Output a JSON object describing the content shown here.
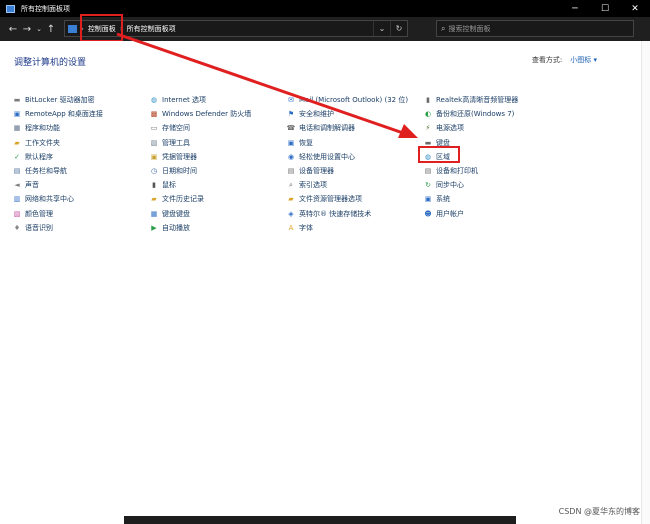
{
  "window": {
    "title": "所有控制面板项",
    "minimize": "─",
    "maximize": "☐",
    "close": "✕"
  },
  "nav": {
    "back": "←",
    "forward": "→",
    "recent": "⌄",
    "up": "↑",
    "breadcrumb": [
      "控制面板",
      "所有控制面板项"
    ],
    "sep": "›",
    "dropdown": "⌄",
    "refresh": "↻",
    "search_placeholder": "搜索控制面板"
  },
  "main": {
    "heading": "调整计算机的设置",
    "view_by_label": "查看方式:",
    "view_by_value": "小图标 ▾"
  },
  "columns": [
    [
      {
        "label": "BitLocker 驱动器加密",
        "icon": "drive-lock-icon",
        "color": "#7a7a7a",
        "glyph": "▬"
      },
      {
        "label": "RemoteApp 和桌面连接",
        "icon": "remote-desktop-icon",
        "color": "#2b6cc4",
        "glyph": "▣"
      },
      {
        "label": "程序和功能",
        "icon": "programs-icon",
        "color": "#5a6c86",
        "glyph": "▦"
      },
      {
        "label": "工作文件夹",
        "icon": "work-folder-icon",
        "color": "#d9a32a",
        "glyph": "▰"
      },
      {
        "label": "默认程序",
        "icon": "default-programs-icon",
        "color": "#2e9e4a",
        "glyph": "✓"
      },
      {
        "label": "任务栏和导航",
        "icon": "taskbar-icon",
        "color": "#4a6a9a",
        "glyph": "▤"
      },
      {
        "label": "声音",
        "icon": "sound-icon",
        "color": "#7a7a7a",
        "glyph": "◄"
      },
      {
        "label": "网络和共享中心",
        "icon": "network-icon",
        "color": "#2b6cc4",
        "glyph": "▥"
      },
      {
        "label": "颜色管理",
        "icon": "color-management-icon",
        "color": "#c84b9e",
        "glyph": "▧"
      },
      {
        "label": "语音识别",
        "icon": "microphone-icon",
        "color": "#888888",
        "glyph": "♦"
      }
    ],
    [
      {
        "label": "Internet 选项",
        "icon": "internet-options-icon",
        "color": "#2b8cc4",
        "glyph": "◍"
      },
      {
        "label": "Windows Defender 防火墙",
        "icon": "firewall-icon",
        "color": "#b04020",
        "glyph": "▩"
      },
      {
        "label": "存储空间",
        "icon": "storage-icon",
        "color": "#6a6a6a",
        "glyph": "▭"
      },
      {
        "label": "管理工具",
        "icon": "admin-tools-icon",
        "color": "#6a7a8a",
        "glyph": "▨"
      },
      {
        "label": "凭据管理器",
        "icon": "credential-icon",
        "color": "#c8a030",
        "glyph": "▣"
      },
      {
        "label": "日期和时间",
        "icon": "clock-icon",
        "color": "#3a6aa4",
        "glyph": "◷"
      },
      {
        "label": "鼠标",
        "icon": "mouse-icon",
        "color": "#555555",
        "glyph": "▮"
      },
      {
        "label": "文件历史记录",
        "icon": "file-history-icon",
        "color": "#d9a32a",
        "glyph": "▰"
      },
      {
        "label": "键盘键盘",
        "icon": "troubleshoot-icon",
        "color": "#2b6cc4",
        "glyph": "▦"
      },
      {
        "label": "自动播放",
        "icon": "autoplay-icon",
        "color": "#2e9e4a",
        "glyph": "▶"
      }
    ],
    [
      {
        "label": "Mail (Microsoft Outlook) (32 位)",
        "icon": "mail-icon",
        "color": "#2b6cc4",
        "glyph": "✉"
      },
      {
        "label": "安全和维护",
        "icon": "flag-icon",
        "color": "#2b6cc4",
        "glyph": "⚑"
      },
      {
        "label": "电话和调制解调器",
        "icon": "phone-icon",
        "color": "#6a6a6a",
        "glyph": "☎"
      },
      {
        "label": "恢复",
        "icon": "recovery-icon",
        "color": "#2b6cc4",
        "glyph": "▣"
      },
      {
        "label": "轻松使用设置中心",
        "icon": "ease-of-access-icon",
        "color": "#2b6cc4",
        "glyph": "◉"
      },
      {
        "label": "设备管理器",
        "icon": "device-manager-icon",
        "color": "#6a6a6a",
        "glyph": "▤"
      },
      {
        "label": "索引选项",
        "icon": "indexing-icon",
        "color": "#6a6a6a",
        "glyph": "⌕"
      },
      {
        "label": "文件资源管理器选项",
        "icon": "folder-options-icon",
        "color": "#d9a32a",
        "glyph": "▰"
      },
      {
        "label": "英特尔® 快速存储技术",
        "icon": "intel-rst-icon",
        "color": "#2b6cc4",
        "glyph": "◈"
      },
      {
        "label": "字体",
        "icon": "fonts-icon",
        "color": "#d9a32a",
        "glyph": "A"
      }
    ],
    [
      {
        "label": "Realtek高清晰音频管理器",
        "icon": "speaker-icon",
        "color": "#6a6a6a",
        "glyph": "▮"
      },
      {
        "label": "备份和还原(Windows 7)",
        "icon": "backup-icon",
        "color": "#2e9e4a",
        "glyph": "◐"
      },
      {
        "label": "电源选项",
        "icon": "power-icon",
        "color": "#4a6a2a",
        "glyph": "⚡"
      },
      {
        "label": "键盘",
        "icon": "keyboard-icon",
        "color": "#6a6a6a",
        "glyph": "▬"
      },
      {
        "label": "区域",
        "icon": "globe-icon",
        "color": "#2b8cc4",
        "glyph": "◍"
      },
      {
        "label": "设备和打印机",
        "icon": "printer-icon",
        "color": "#6a6a6a",
        "glyph": "▤"
      },
      {
        "label": "同步中心",
        "icon": "sync-icon",
        "color": "#2e9e4a",
        "glyph": "↻"
      },
      {
        "label": "系统",
        "icon": "system-icon",
        "color": "#2b6cc4",
        "glyph": "▣"
      },
      {
        "label": "用户帐户",
        "icon": "user-accounts-icon",
        "color": "#2b6cc4",
        "glyph": "☻"
      }
    ]
  ],
  "watermark": "CSDN @夏华东的博客"
}
